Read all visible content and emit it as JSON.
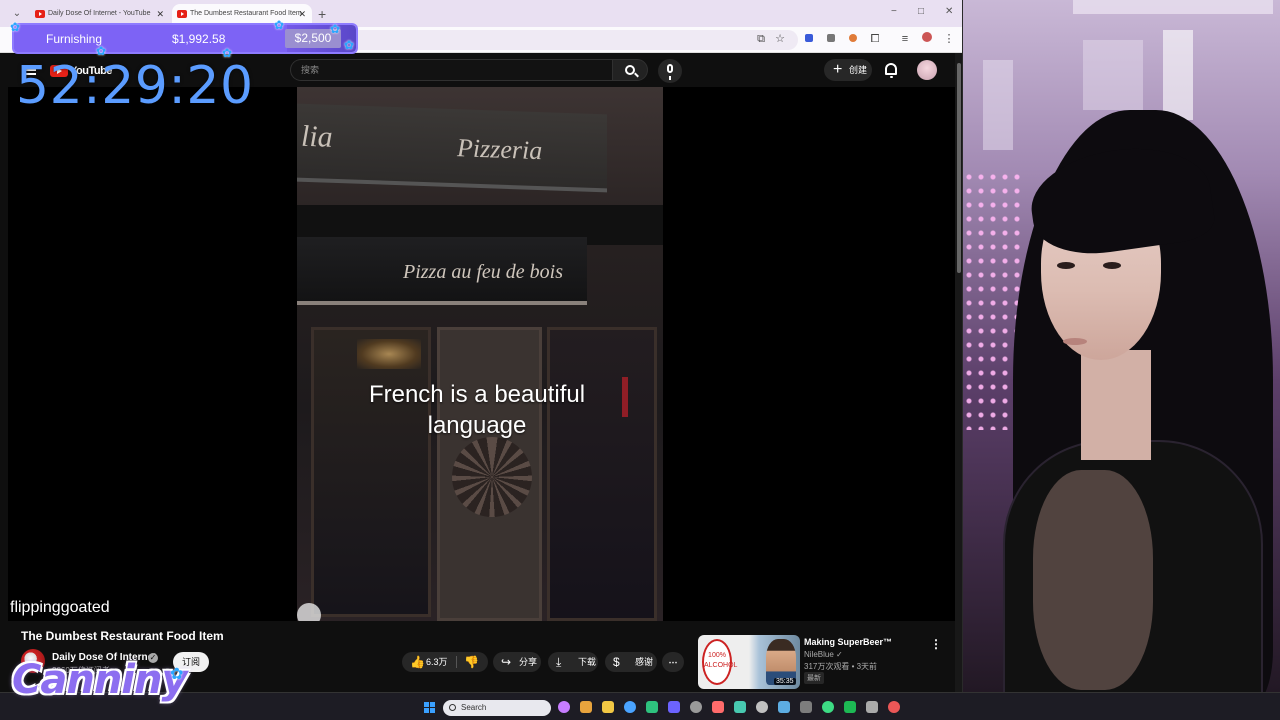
{
  "browser": {
    "tabs": [
      {
        "title": "Daily Dose Of Internet - YouTube",
        "close": "✕",
        "active": false
      },
      {
        "title": "The Dumbest Restaurant Food Item",
        "close": "✕",
        "active": true
      }
    ],
    "new_tab": "+",
    "window_controls": {
      "minimize": "−",
      "maximize": "□",
      "close": "✕"
    },
    "toolbar_icons": [
      "install-icon",
      "bookmark-star-icon",
      "extension-icon",
      "extension-icon",
      "extension-icon",
      "puzzle-icon",
      "media-icon",
      "profile-icon",
      "menu-icon"
    ]
  },
  "youtube": {
    "logo_text": "YouTube",
    "search_placeholder": "搜索",
    "create_label": "创建",
    "create_plus": "+",
    "video": {
      "sign_top_left": "lia",
      "sign_top_right": "Pizzeria",
      "sign_mid": "Pizza au feu de bois",
      "caption_line1": "French is a beautiful",
      "caption_line2": "language"
    },
    "title": "The Dumbest Restaurant Food Item",
    "channel": {
      "name": "Daily Dose Of Internet",
      "verified_mark": "✓",
      "subscribers": "2060万位订阅者",
      "subscribe_label": "订阅"
    },
    "actions": {
      "like_icon": "👍",
      "like_count": "6.3万",
      "dislike_icon": "👎",
      "share_icon": "↪",
      "share_label": "分享",
      "download_icon": "⤓",
      "download_label": "下载",
      "thanks_icon": "$",
      "thanks_label": "感谢",
      "more": "⋯"
    },
    "recommendation": {
      "thumb_text": "100% ALCOHOL",
      "duration": "35:35",
      "title": "Making SuperBeer™",
      "channel": "NileBlue ✓",
      "meta": "317万次观看 • 3天前",
      "badge": "最新",
      "menu": "⋮"
    }
  },
  "taskbar": {
    "search_placeholder": "Search",
    "icon_colors": [
      "#c77dff",
      "#e8a33d",
      "#f2c744",
      "#4aa3ff",
      "#2ec27e",
      "#6c63ff",
      "#9a9a9a",
      "#ff6b6b",
      "#48c9b0",
      "#c0c0c0",
      "#5dade2",
      "#7d7d7d",
      "#3ddc84",
      "#1db954",
      "#aaaaaa",
      "#eb5757"
    ]
  },
  "overlay": {
    "goal_label": "Furnishing",
    "goal_current": "$1,992.58",
    "goal_target": "$2,500",
    "goal_progress": 0.797,
    "timer": "52:29:20",
    "chatter": "flippinggoated",
    "streamer_logo": "Canniny"
  }
}
